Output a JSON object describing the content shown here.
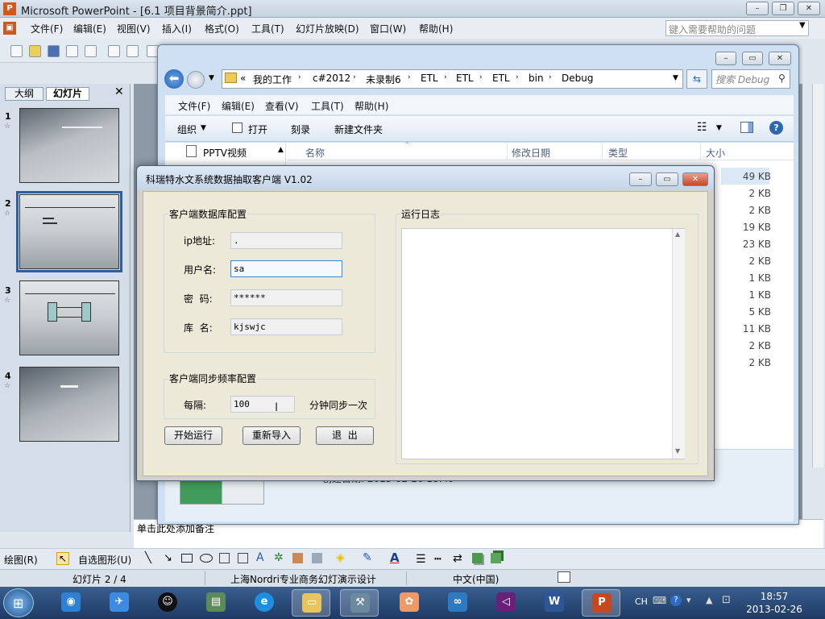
{
  "powerpoint": {
    "title": "Microsoft PowerPoint - [6.1 项目背景简介.ppt]",
    "menu": [
      "文件(F)",
      "编辑(E)",
      "视图(V)",
      "插入(I)",
      "格式(O)",
      "工具(T)",
      "幻灯片放映(D)",
      "窗口(W)",
      "帮助(H)"
    ],
    "help_placeholder": "键入需要帮助的问题",
    "panel_tabs": [
      "大纲",
      "幻灯片"
    ],
    "slide_numbers": [
      "1",
      "2",
      "3",
      "4"
    ],
    "notes_placeholder": "单击此处添加备注",
    "drawing_label": "绘图(R)",
    "autoshape_label": "自选图形(U)",
    "status": {
      "slide": "幻灯片 2 / 4",
      "design": "上海Nordri专业商务幻灯演示设计",
      "language": "中文(中国)"
    }
  },
  "explorer": {
    "path": [
      "«",
      "我的工作",
      "c#2012",
      "未录制6",
      "ETL",
      "ETL",
      "ETL",
      "bin",
      "Debug"
    ],
    "search_placeholder": "搜索 Debug",
    "menu": [
      "文件(F)",
      "编辑(E)",
      "查看(V)",
      "工具(T)",
      "帮助(H)"
    ],
    "commands": [
      "组织",
      "打开",
      "刻录",
      "新建文件夹"
    ],
    "nav_item": "PPTV视频",
    "columns": [
      "名称",
      "修改日期",
      "类型",
      "大小"
    ],
    "sizes": [
      "49 KB",
      "2 KB",
      "2 KB",
      "19 KB",
      "23 KB",
      "2 KB",
      "1 KB",
      "1 KB",
      "5 KB",
      "11 KB",
      "2 KB",
      "2 KB"
    ],
    "preview_created": "创建日期: 2013-02-26 18:49"
  },
  "dialog": {
    "title": "科瑞特水文系统数据抽取客户端 V1.02",
    "db_group": "客户端数据库配置",
    "ip_label": "ip地址:",
    "ip_value": ".",
    "user_label": "用户名:",
    "user_value": "sa",
    "pwd_label": "密  码:",
    "pwd_value": "******",
    "db_label": "库  名:",
    "db_value": "kjswjc",
    "sync_group": "客户端同步频率配置",
    "interval_label": "每隔:",
    "interval_value": "100",
    "interval_suffix": "分钟同步一次",
    "log_group": "运行日志",
    "buttons": {
      "start": "开始运行",
      "reimport": "重新导入",
      "exit": "退  出"
    }
  },
  "taskbar": {
    "lang": "CH",
    "time": "18:57",
    "date": "2013-02-26"
  }
}
